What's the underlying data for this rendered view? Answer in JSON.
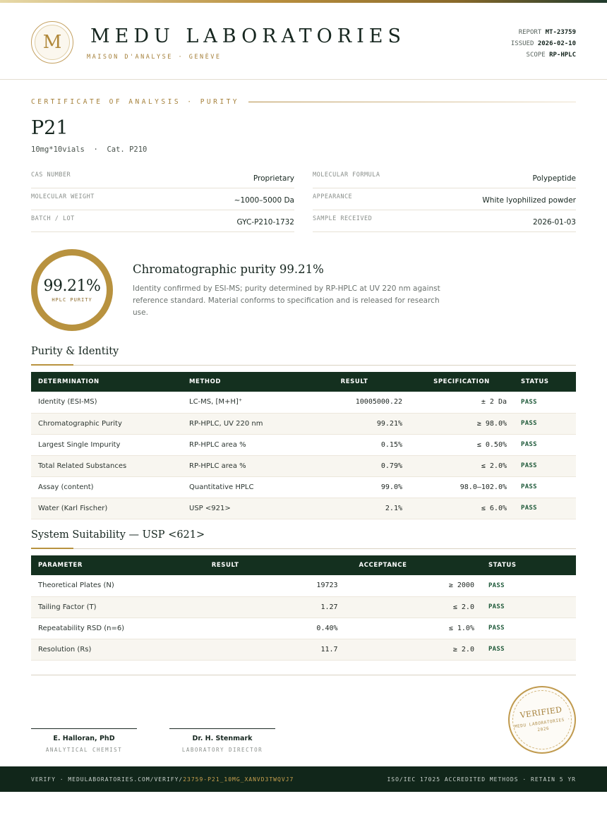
{
  "header": {
    "logo_letter": "M",
    "brand_name": "MEDU LABORATORIES",
    "brand_sub": "MAISON D'ANALYSE · GENÈVE",
    "report_label": "REPORT",
    "report_value": "MT-23759",
    "issued_label": "ISSUED",
    "issued_value": "2026-02-10",
    "scope_label": "SCOPE",
    "scope_value": "RP-HPLC"
  },
  "certificate": {
    "label": "CERTIFICATE OF ANALYSIS · PURITY",
    "title": "P21",
    "subtitle": "10mg*10vials  ·  Cat. P210"
  },
  "info": [
    {
      "key": "CAS NUMBER",
      "value": "Proprietary"
    },
    {
      "key": "MOLECULAR FORMULA",
      "value": "Polypeptide"
    },
    {
      "key": "MOLECULAR WEIGHT",
      "value": "~1000–5000 Da"
    },
    {
      "key": "APPEARANCE",
      "value": "White lyophilized powder"
    },
    {
      "key": "BATCH / LOT",
      "value": "GYC-P210-1732"
    },
    {
      "key": "SAMPLE RECEIVED",
      "value": "2026-01-03"
    }
  ],
  "purity": {
    "value": "99.21%",
    "label": "HPLC PURITY",
    "summary_title": "Chromatographic purity 99.21%",
    "summary_text": "Identity confirmed by ESI-MS; purity determined by RP-HPLC at UV 220 nm against reference standard. Material conforms to specification and is released for research use."
  },
  "purity_table": {
    "title": "Purity & Identity",
    "headers": [
      "DETERMINATION",
      "METHOD",
      "RESULT",
      "SPECIFICATION",
      "STATUS"
    ],
    "rows": [
      [
        "Identity (ESI-MS)",
        "LC-MS, [M+H]⁺",
        "10005000.22",
        "± 2 Da",
        "PASS"
      ],
      [
        "Chromatographic Purity",
        "RP-HPLC, UV 220 nm",
        "99.21%",
        "≥ 98.0%",
        "PASS"
      ],
      [
        "Largest Single Impurity",
        "RP-HPLC area %",
        "0.15%",
        "≤ 0.50%",
        "PASS"
      ],
      [
        "Total Related Substances",
        "RP-HPLC area %",
        "0.79%",
        "≤ 2.0%",
        "PASS"
      ],
      [
        "Assay (content)",
        "Quantitative HPLC",
        "99.0%",
        "98.0–102.0%",
        "PASS"
      ],
      [
        "Water (Karl Fischer)",
        "USP <921>",
        "2.1%",
        "≤ 6.0%",
        "PASS"
      ]
    ]
  },
  "suitability_table": {
    "title": "System Suitability — USP <621>",
    "headers": [
      "PARAMETER",
      "RESULT",
      "ACCEPTANCE",
      "STATUS"
    ],
    "rows": [
      [
        "Theoretical Plates (N)",
        "19723",
        "≥ 2000",
        "PASS"
      ],
      [
        "Tailing Factor (T)",
        "1.27",
        "≤ 2.0",
        "PASS"
      ],
      [
        "Repeatability RSD (n=6)",
        "0.40%",
        "≤ 1.0%",
        "PASS"
      ],
      [
        "Resolution (Rs)",
        "11.7",
        "≥ 2.0",
        "PASS"
      ]
    ]
  },
  "signatures": [
    {
      "name": "E. Halloran, PhD",
      "role": "ANALYTICAL CHEMIST"
    },
    {
      "name": "Dr. H. Stenmark",
      "role": "LABORATORY DIRECTOR"
    }
  ],
  "seal": {
    "main": "VERIFIED",
    "sub": "MEDU LABORATORIES · 2026"
  },
  "footer": {
    "verify_prefix": "VERIFY · MEDULABORATORIES.COM/VERIFY/",
    "verify_code": "23759-P21_10MG_XANVD3TWQVJ7",
    "right": "ISO/IEC 17025 ACCREDITED METHODS · RETAIN 5 YR"
  }
}
